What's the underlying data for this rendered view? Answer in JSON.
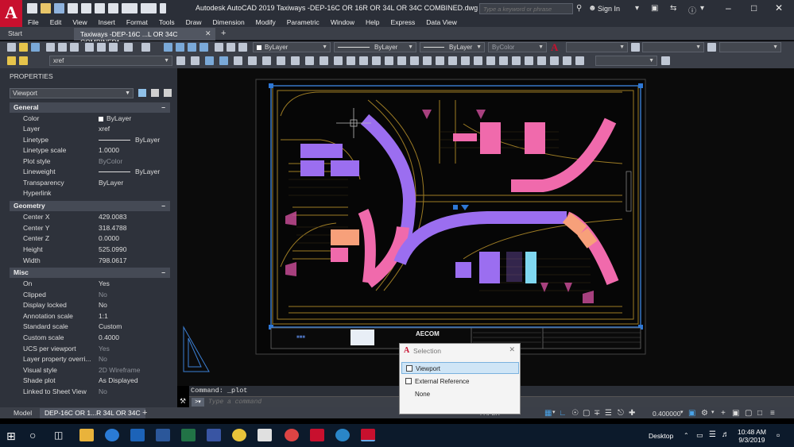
{
  "titlebar": {
    "app_logo": "A",
    "title": "Autodesk AutoCAD 2019      Taxiways -DEP-16C OR 16R OR 34L OR 34C COMBINED.dwg",
    "search_placeholder": "Type a keyword or phrase",
    "sign_in": "Sign In"
  },
  "menu": [
    "File",
    "Edit",
    "View",
    "Insert",
    "Format",
    "Tools",
    "Draw",
    "Dimension",
    "Modify",
    "Parametric",
    "Window",
    "Help",
    "Express",
    "Data View"
  ],
  "doc_tabs": {
    "start": "Start",
    "active": "Taxiways -DEP-16C ...L OR 34C COMBINED*"
  },
  "toolbar": {
    "layer_value": "xref",
    "color_value": "ByLayer",
    "linetype_value": "ByLayer",
    "lineweight_value": "ByLayer",
    "plotstyle_value": "ByColor"
  },
  "properties": {
    "title": "PROPERTIES",
    "selection": "Viewport",
    "sections": {
      "general": "General",
      "geometry": "Geometry",
      "misc": "Misc"
    },
    "general": [
      {
        "name": "Color",
        "value": "ByLayer"
      },
      {
        "name": "Layer",
        "value": "xref"
      },
      {
        "name": "Linetype",
        "value": "ByLayer"
      },
      {
        "name": "Linetype scale",
        "value": "1.0000"
      },
      {
        "name": "Plot style",
        "value": "ByColor"
      },
      {
        "name": "Lineweight",
        "value": "ByLayer"
      },
      {
        "name": "Transparency",
        "value": "ByLayer"
      },
      {
        "name": "Hyperlink",
        "value": ""
      }
    ],
    "geometry": [
      {
        "name": "Center X",
        "value": "429.0083"
      },
      {
        "name": "Center Y",
        "value": "318.4788"
      },
      {
        "name": "Center Z",
        "value": "0.0000"
      },
      {
        "name": "Height",
        "value": "525.0990"
      },
      {
        "name": "Width",
        "value": "798.0617"
      }
    ],
    "misc": [
      {
        "name": "On",
        "value": "Yes"
      },
      {
        "name": "Clipped",
        "value": "No"
      },
      {
        "name": "Display locked",
        "value": "No"
      },
      {
        "name": "Annotation scale",
        "value": "1:1"
      },
      {
        "name": "Standard scale",
        "value": "Custom"
      },
      {
        "name": "Custom scale",
        "value": "0.4000"
      },
      {
        "name": "UCS per viewport",
        "value": "Yes"
      },
      {
        "name": "Layer property overri...",
        "value": "No"
      },
      {
        "name": "Visual style",
        "value": "2D Wireframe"
      },
      {
        "name": "Shade plot",
        "value": "As Displayed"
      },
      {
        "name": "Linked to Sheet View",
        "value": "No"
      }
    ]
  },
  "command": {
    "history": "Command: _plot",
    "placeholder": "Type a command"
  },
  "layout_tabs": {
    "model": "Model",
    "layout": "DEP-16C OR 1...R 34L OR 34C"
  },
  "statusbar": {
    "paper": "PAPER",
    "scale": "0.400000"
  },
  "selection_popup": {
    "title": "Selection",
    "items": [
      "Viewport",
      "External Reference",
      "None"
    ]
  },
  "drawing": {
    "logo_text": "AECOM"
  },
  "taskbar": {
    "desktop": "Desktop",
    "time": "10:48 AM",
    "date": "9/3/2019"
  }
}
